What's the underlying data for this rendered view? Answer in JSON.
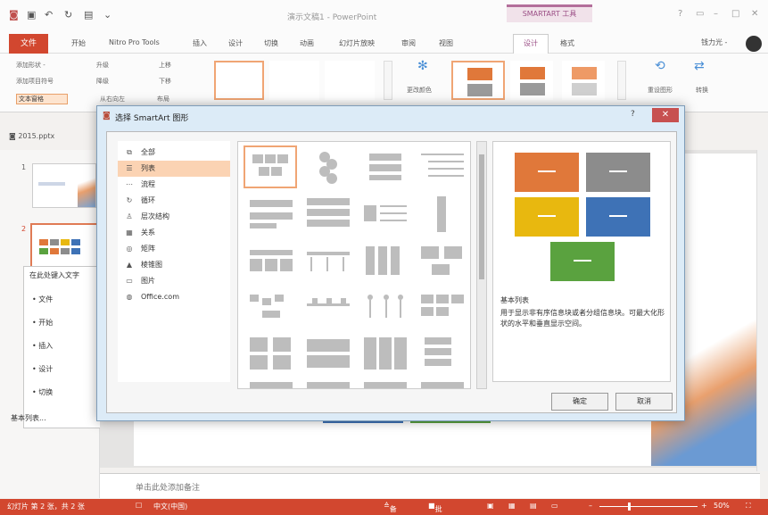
{
  "app": {
    "title": "演示文稿1 - PowerPoint",
    "contextual_tab_group": "SMARTART 工具",
    "user": "钱力光 -"
  },
  "tabs": [
    "文件",
    "开始",
    "Nitro Pro Tools",
    "插入",
    "设计",
    "切换",
    "动画",
    "幻灯片放映",
    "审阅",
    "视图",
    "设计",
    "格式"
  ],
  "ribbon": {
    "create_group": [
      "添加形状 -",
      "添加项目符号",
      "文本窗格",
      "升级",
      "降级",
      "从右向左",
      "上移",
      "下移",
      "布局"
    ],
    "change_colors_label": "更改颜色",
    "reset_graphic_label": "重设图形",
    "convert_label": "转换"
  },
  "left_pane": {
    "file_tab": "2015.pptx",
    "slide_numbers": [
      "1",
      "2"
    ]
  },
  "text_pane": {
    "title": "在此处键入文字",
    "items": [
      "文件",
      "开始",
      "插入",
      "设计",
      "切换"
    ],
    "footer": "基本列表..."
  },
  "dialog": {
    "title": "选择 SmartArt 图形",
    "help": "?",
    "close": "✕",
    "categories": [
      {
        "icon": "⧉",
        "label": "全部"
      },
      {
        "icon": "☰",
        "label": "列表"
      },
      {
        "icon": "⋯",
        "label": "流程"
      },
      {
        "icon": "↻",
        "label": "循环"
      },
      {
        "icon": "♙",
        "label": "层次结构"
      },
      {
        "icon": "▦",
        "label": "关系"
      },
      {
        "icon": "◎",
        "label": "矩阵"
      },
      {
        "icon": "▲",
        "label": "棱锥图"
      },
      {
        "icon": "▭",
        "label": "图片"
      },
      {
        "icon": "◍",
        "label": "Office.com"
      }
    ],
    "selected_category": "列表",
    "preview_name": "基本列表",
    "preview_description": "用于显示非有序信息块或者分组信息块。可最大化形状的水平和垂直显示空间。",
    "ok_label": "确定",
    "cancel_label": "取消",
    "preview_colors": [
      "#e0783a",
      "#8c8c8c",
      "#e8b80f",
      "#3e72b6",
      "#5aa23f"
    ]
  },
  "notes": {
    "placeholder": "单击此处添加备注"
  },
  "status_bar": {
    "slide_info": "幻灯片 第 2 张，共 2 张",
    "language": "中文(中国)",
    "notes_label": "备注",
    "comments_label": "批注",
    "zoom": "50%"
  }
}
